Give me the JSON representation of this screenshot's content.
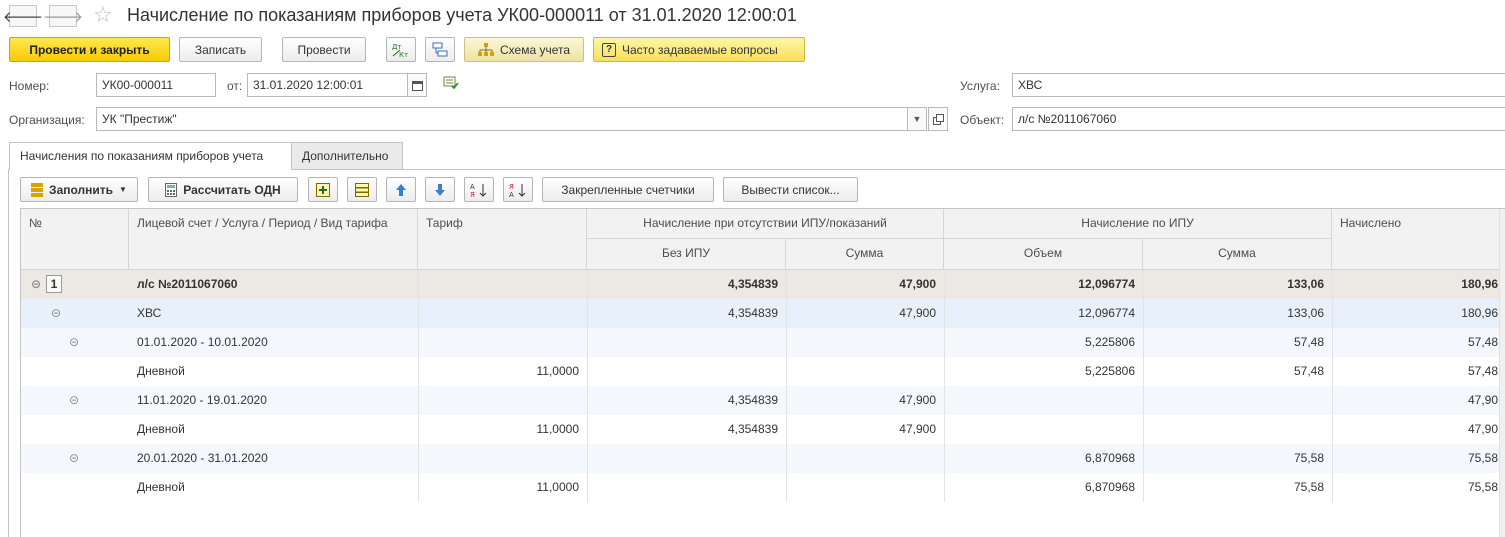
{
  "window": {
    "title": "Начисление по показаниям приборов учета УК00-000011 от 31.01.2020 12:00:01"
  },
  "toolbar": {
    "post_close": "Провести и закрыть",
    "save": "Записать",
    "post": "Провести",
    "dt_kt": "Дт Кт",
    "scheme": "Схема учета",
    "faq": "Часто задаваемые вопросы"
  },
  "form": {
    "number_label": "Номер:",
    "number_value": "УК00-000011",
    "date_label": "от:",
    "date_value": "31.01.2020 12:00:01",
    "org_label": "Организация:",
    "org_value": "УК \"Престиж\"",
    "service_label": "Услуга:",
    "service_value": "ХВС",
    "object_label": "Объект:",
    "object_value": "л/с №2011067060"
  },
  "tabs": [
    {
      "label": "Начисления по показаниям приборов учета"
    },
    {
      "label": "Дополнительно"
    }
  ],
  "table_toolbar": {
    "fill": "Заполнить",
    "calc_odn": "Рассчитать ОДН",
    "assigned_meters": "Закрепленные счетчики",
    "print_list": "Вывести список..."
  },
  "table": {
    "headers": {
      "num": "№",
      "account": "Лицевой счет / Услуга / Период / Вид тарифа",
      "tariff": "Тариф",
      "no_ipu_group": "Начисление при отсутствии ИПУ/показаний",
      "no_ipu": "Без ИПУ",
      "no_ipu_sum": "Сумма",
      "ipu_group": "Начисление по ИПУ",
      "ipu_volume": "Объем",
      "ipu_sum": "Сумма",
      "charged": "Начислено"
    },
    "rows": [
      {
        "level": 0,
        "num": "1",
        "name": "л/с №2011067060",
        "tariff": "",
        "no_ipu": "4,354839",
        "no_ipu_sum": "47,900",
        "ipu_volume": "12,096774",
        "ipu_sum": "133,06",
        "charged": "180,96"
      },
      {
        "level": 1,
        "num": "",
        "name": "ХВС",
        "tariff": "",
        "no_ipu": "4,354839",
        "no_ipu_sum": "47,900",
        "ipu_volume": "12,096774",
        "ipu_sum": "133,06",
        "charged": "180,96"
      },
      {
        "level": 2,
        "num": "",
        "name": "01.01.2020 - 10.01.2020",
        "tariff": "",
        "no_ipu": "",
        "no_ipu_sum": "",
        "ipu_volume": "5,225806",
        "ipu_sum": "57,48",
        "charged": "57,48"
      },
      {
        "level": 3,
        "num": "",
        "name": "Дневной",
        "tariff": "11,0000",
        "no_ipu": "",
        "no_ipu_sum": "",
        "ipu_volume": "5,225806",
        "ipu_sum": "57,48",
        "charged": "57,48"
      },
      {
        "level": 2,
        "num": "",
        "name": "11.01.2020 - 19.01.2020",
        "tariff": "",
        "no_ipu": "4,354839",
        "no_ipu_sum": "47,900",
        "ipu_volume": "",
        "ipu_sum": "",
        "charged": "47,90"
      },
      {
        "level": 3,
        "num": "",
        "name": "Дневной",
        "tariff": "11,0000",
        "no_ipu": "4,354839",
        "no_ipu_sum": "47,900",
        "ipu_volume": "",
        "ipu_sum": "",
        "charged": "47,90"
      },
      {
        "level": 2,
        "num": "",
        "name": "20.01.2020 - 31.01.2020",
        "tariff": "",
        "no_ipu": "",
        "no_ipu_sum": "",
        "ipu_volume": "6,870968",
        "ipu_sum": "75,58",
        "charged": "75,58"
      },
      {
        "level": 3,
        "num": "",
        "name": "Дневной",
        "tariff": "11,0000",
        "no_ipu": "",
        "no_ipu_sum": "",
        "ipu_volume": "6,870968",
        "ipu_sum": "75,58",
        "charged": "75,58"
      }
    ]
  },
  "icons": {
    "back": "arrow-left-icon",
    "forward": "arrow-right-icon",
    "favorite": "star-icon",
    "collapse": "minus-circle-icon"
  }
}
